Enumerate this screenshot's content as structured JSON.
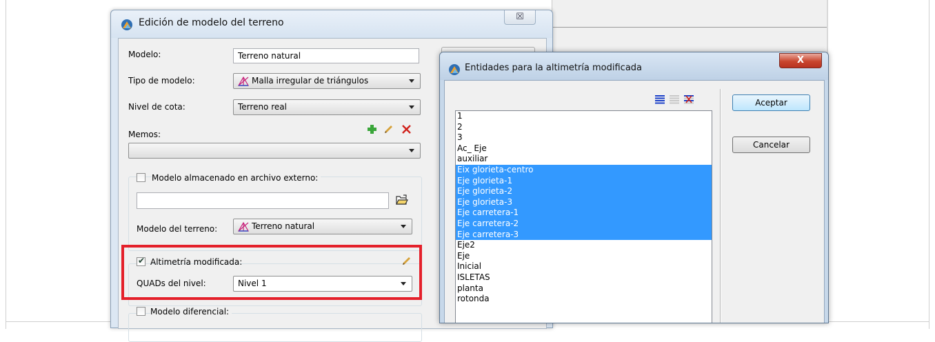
{
  "dialog1": {
    "title": "Edición de modelo del terreno",
    "close_label": "☒",
    "model_label": "Modelo:",
    "model_value": "Terreno natural",
    "model_type_label": "Tipo de modelo:",
    "model_type_value": "Malla irregular de triángulos",
    "level_label": "Nivel de cota:",
    "level_value": "Terreno real",
    "memos_label": "Memos:",
    "memos_value": "",
    "external_label": "Modelo almacenado en archivo externo:",
    "external_path": "",
    "terrain_model_label": "Modelo del terreno:",
    "terrain_model_value": "Terreno natural",
    "altimetry_label": "Altimetría modificada:",
    "altimetry_checked": true,
    "quads_label": "QUADs del nivel:",
    "quads_value": "Nivel 1",
    "differential_label": "Modelo diferencial:"
  },
  "dialog2": {
    "title": "Entidades para la altimetría modificada",
    "close_label": "X",
    "accept_label": "Aceptar",
    "cancel_label": "Cancelar",
    "items": [
      {
        "label": "1",
        "selected": false
      },
      {
        "label": "2",
        "selected": false
      },
      {
        "label": "3",
        "selected": false
      },
      {
        "label": "Ac_ Eje",
        "selected": false
      },
      {
        "label": "auxiliar",
        "selected": false
      },
      {
        "label": "Eix glorieta-centro",
        "selected": true
      },
      {
        "label": "Eje  glorieta-1",
        "selected": true
      },
      {
        "label": "Eje  glorieta-2",
        "selected": true
      },
      {
        "label": "Eje  glorieta-3",
        "selected": true
      },
      {
        "label": "Eje carretera-1",
        "selected": true
      },
      {
        "label": "Eje carretera-2",
        "selected": true
      },
      {
        "label": "Eje carretera-3",
        "selected": true
      },
      {
        "label": "Eje2",
        "selected": false
      },
      {
        "label": "Eje",
        "selected": false
      },
      {
        "label": "Inicial",
        "selected": false
      },
      {
        "label": "ISLETAS",
        "selected": false
      },
      {
        "label": "planta",
        "selected": false
      },
      {
        "label": "rotonda",
        "selected": false
      }
    ]
  },
  "colors": {
    "selection": "#3399ff",
    "highlight_box": "#e4202a",
    "add_icon": "#3aa63a",
    "delete_icon": "#d0201a",
    "edit_icon": "#d6a23a"
  }
}
